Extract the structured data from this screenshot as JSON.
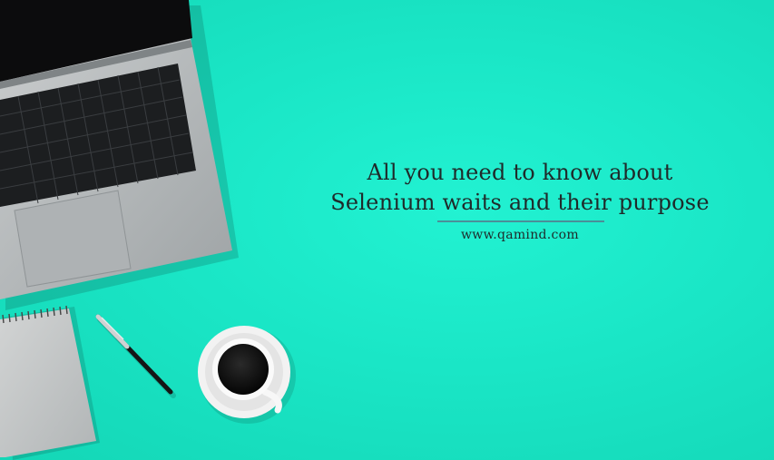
{
  "headline": {
    "line1": "All you need to know about",
    "line2": "Selenium waits and their purpose"
  },
  "website": "www.qamind.com",
  "colors": {
    "background": "#1ae6c6",
    "text": "#1f2a2a",
    "laptop_body": "#b8bcbd",
    "keyboard": "#202224",
    "coffee": "#141414",
    "rule": "#5a6f86"
  },
  "decor": {
    "objects": [
      "laptop",
      "notepad",
      "pen",
      "coffee-cup"
    ]
  }
}
